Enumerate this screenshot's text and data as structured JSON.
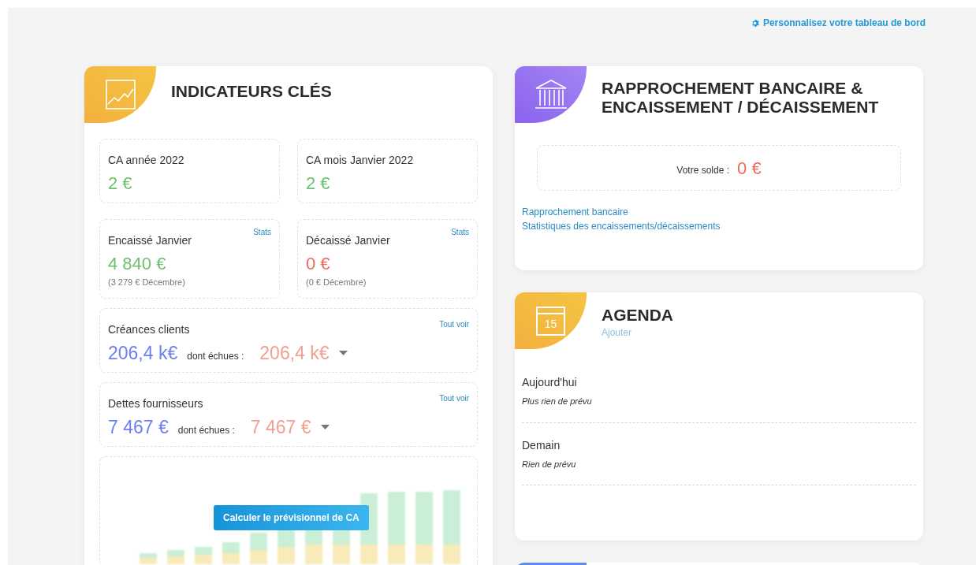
{
  "header_link": "Personnalisez votre tableau de bord",
  "key_indicators": {
    "title": "INDICATEURS CLÉS",
    "tiles": [
      {
        "label": "CA année 2022",
        "value": "2 €",
        "color": "#6cc070"
      },
      {
        "label": "CA mois Janvier 2022",
        "value": "2 €",
        "color": "#6cc070"
      },
      {
        "label": "Encaissé Janvier",
        "link": "Stats",
        "value": "4 840 €",
        "color": "#6cc070",
        "previous": "(3 279 € Décembre)"
      },
      {
        "label": "Décaissé Janvier",
        "link": "Stats",
        "value": "0 €",
        "color": "#f0685a",
        "previous": "(0 € Décembre)"
      }
    ],
    "balances": [
      {
        "label": "Créances clients",
        "link": "Tout voir",
        "total": "206,4 k€",
        "overdue_label": "dont échues :",
        "overdue": "206,4 k€"
      },
      {
        "label": "Dettes fournisseurs",
        "link": "Tout voir",
        "total": "7 467 €",
        "overdue_label": "dont échues :",
        "overdue": "7 467 €"
      }
    ],
    "forecast_button": "Calculer le prévisionnel de CA"
  },
  "bank": {
    "title": "RAPPROCHEMENT BANCAIRE & ENCAISSEMENT / DÉCAISSEMENT",
    "balance_label": "Votre solde :",
    "balance": "0 €",
    "links": [
      "Rapprochement bancaire",
      "Statistiques des encaissements/décaissements"
    ]
  },
  "agenda": {
    "title": "AGENDA",
    "add_link": "Ajouter",
    "calendar_day": "15",
    "days": [
      {
        "label": "Aujourd'hui",
        "note": "Plus rien de prévu"
      },
      {
        "label": "Demain",
        "note": "Rien de prévu"
      }
    ]
  }
}
